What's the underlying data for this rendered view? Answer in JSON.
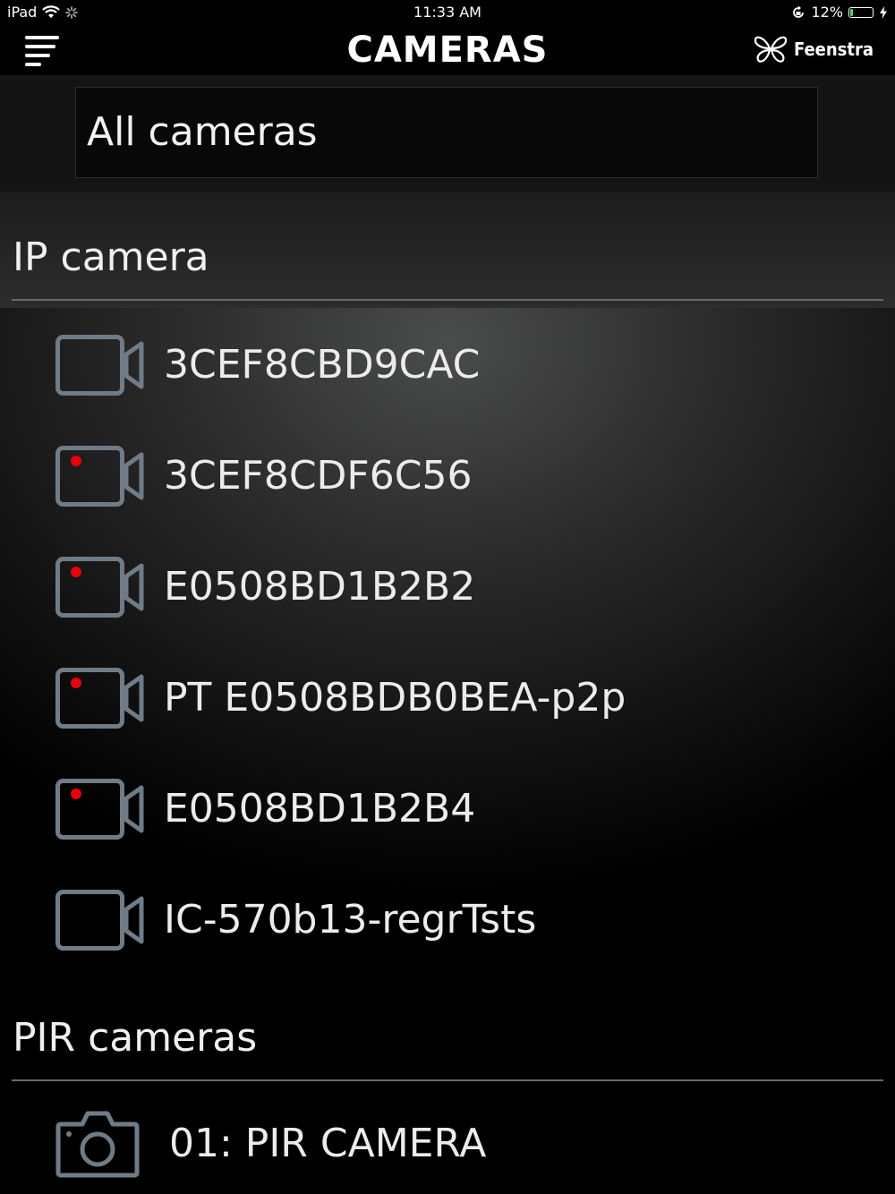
{
  "status_bar": {
    "device": "iPad",
    "time": "11:33 AM",
    "battery_percent": "12%",
    "battery_level": 0.12
  },
  "header": {
    "title": "CAMERAS",
    "brand": "Feenstra"
  },
  "filter": {
    "selected": "All cameras"
  },
  "sections": {
    "ip": {
      "title": "IP camera",
      "cameras": [
        {
          "name": "3CEF8CBD9CAC",
          "recording": false
        },
        {
          "name": "3CEF8CDF6C56",
          "recording": true
        },
        {
          "name": "E0508BD1B2B2",
          "recording": true
        },
        {
          "name": "PT E0508BDB0BEA-p2p",
          "recording": true
        },
        {
          "name": "E0508BD1B2B4",
          "recording": true
        },
        {
          "name": "IC-570b13-regrTsts",
          "recording": false
        }
      ]
    },
    "pir": {
      "title": "PIR cameras",
      "cameras": [
        {
          "name": "01: PIR CAMERA"
        }
      ]
    }
  },
  "colors": {
    "icon_stroke": "#6f7c88",
    "recording_dot": "#e8000b",
    "battery": "#4cd964"
  }
}
